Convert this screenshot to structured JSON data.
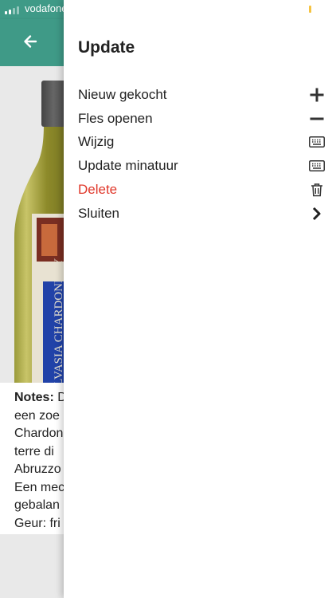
{
  "status": {
    "carrier": "vodafone"
  },
  "header": {
    "back_icon": "arrow-left-icon"
  },
  "colors": {
    "primary": "#3f9a87",
    "danger": "#e0372a",
    "accent": "#f5c342"
  },
  "product": {
    "bottle_label_text": "MALVASIA CHARDONNAY",
    "notes_label": "Notes:",
    "notes_lines": [
      "D",
      "een zoe",
      "Chardon",
      "terre di",
      "Abruzzo",
      "Een mec",
      "gebalan",
      "Geur: fri"
    ]
  },
  "drawer": {
    "title": "Update",
    "items": [
      {
        "label": "Nieuw gekocht",
        "icon": "plus-icon"
      },
      {
        "label": "Fles openen",
        "icon": "minus-icon"
      },
      {
        "label": "Wijzig",
        "icon": "keyboard-icon"
      },
      {
        "label": "Update minatuur",
        "icon": "keyboard-icon"
      },
      {
        "label": "Delete",
        "icon": "trash-icon"
      },
      {
        "label": "Sluiten",
        "icon": "chevron-right-icon"
      }
    ]
  }
}
